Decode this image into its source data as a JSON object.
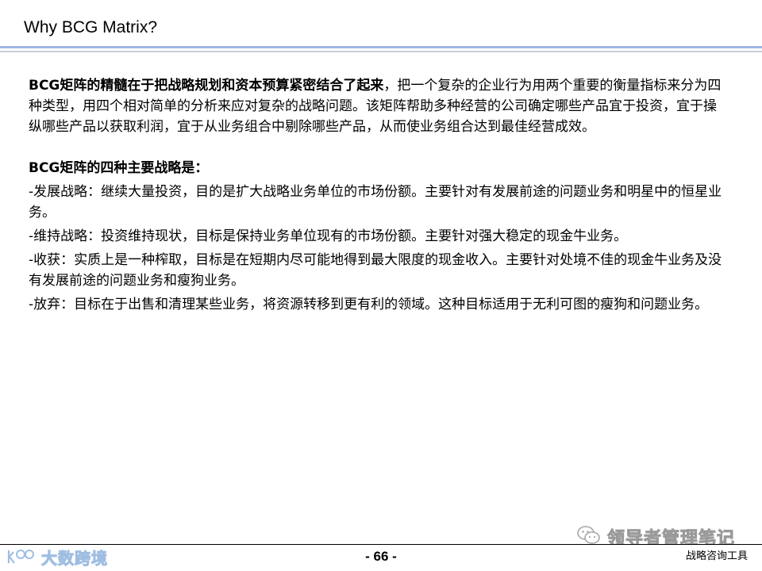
{
  "slide": {
    "title": "Why BCG Matrix?"
  },
  "intro": {
    "lead": "BCG矩阵的精髓在于把战略规划和资本预算紧密结合了起来",
    "text": "，把一个复杂的企业行为用两个重要的衡量指标来分为四种类型，用四个相对简单的分析来应对复杂的战略问题。该矩阵帮助多种经营的公司确定哪些产品宜于投资，宜于操纵哪些产品以获取利润，宜于从业务组合中剔除哪些产品，从而使业务组合达到最佳经营成效。"
  },
  "strategies": {
    "heading": "BCG矩阵的四种主要战略是：",
    "items": [
      "-发展战略：继续大量投资，目的是扩大战略业务单位的市场份额。主要针对有发展前途的问题业务和明星中的恒星业务。",
      "-维持战略：投资维持现状，目标是保持业务单位现有的市场份额。主要针对强大稳定的现金牛业务。",
      "-收获：实质上是一种榨取，目标是在短期内尽可能地得到最大限度的现金收入。主要针对处境不佳的现金牛业务及没有发展前途的问题业务和瘦狗业务。",
      "-放弃：目标在于出售和清理某些业务，将资源转移到更有利的领域。这种目标适用于无利可图的瘦狗和问题业务。"
    ]
  },
  "footer": {
    "logo_text": "大数跨境",
    "page_number": "- 66 -",
    "caption": "战略咨询工具",
    "watermark_text": "领导者管理笔记"
  },
  "icons": {
    "logo": "k100-logo-icon",
    "watermark": "wechat-icon"
  },
  "colors": {
    "title_rule": "#9fb6e6",
    "logo": "#8fb3dd"
  }
}
